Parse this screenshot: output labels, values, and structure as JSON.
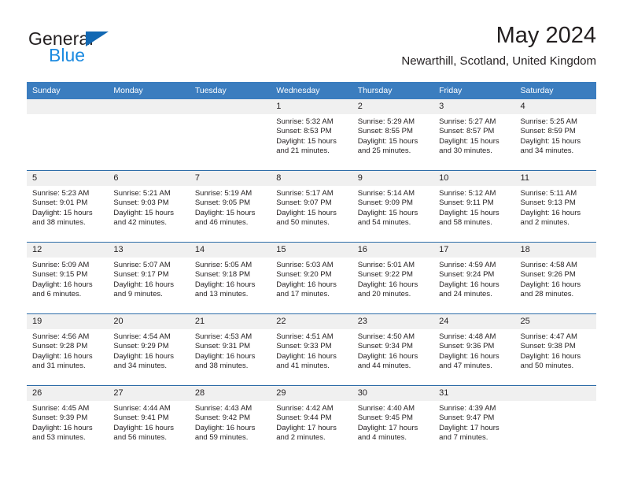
{
  "brand": {
    "name_part1": "General",
    "name_part2": "Blue",
    "accent_color": "#1268b3",
    "blue_text_color": "#1b8ae0"
  },
  "header": {
    "title": "May 2024",
    "subtitle": "Newarthill, Scotland, United Kingdom"
  },
  "theme": {
    "header_row_bg": "#3b7dbf",
    "row_divider": "#2e6da8",
    "daynum_bg": "#f0f0f0"
  },
  "weekday_headers": [
    "Sunday",
    "Monday",
    "Tuesday",
    "Wednesday",
    "Thursday",
    "Friday",
    "Saturday"
  ],
  "labels": {
    "sunrise_prefix": "Sunrise:",
    "sunset_prefix": "Sunset:",
    "daylight_prefix": "Daylight:"
  },
  "weeks": [
    [
      {
        "day": "",
        "empty": true
      },
      {
        "day": "",
        "empty": true
      },
      {
        "day": "",
        "empty": true
      },
      {
        "day": "1",
        "sunrise": "Sunrise: 5:32 AM",
        "sunset": "Sunset: 8:53 PM",
        "daylight_1": "Daylight: 15 hours",
        "daylight_2": "and 21 minutes."
      },
      {
        "day": "2",
        "sunrise": "Sunrise: 5:29 AM",
        "sunset": "Sunset: 8:55 PM",
        "daylight_1": "Daylight: 15 hours",
        "daylight_2": "and 25 minutes."
      },
      {
        "day": "3",
        "sunrise": "Sunrise: 5:27 AM",
        "sunset": "Sunset: 8:57 PM",
        "daylight_1": "Daylight: 15 hours",
        "daylight_2": "and 30 minutes."
      },
      {
        "day": "4",
        "sunrise": "Sunrise: 5:25 AM",
        "sunset": "Sunset: 8:59 PM",
        "daylight_1": "Daylight: 15 hours",
        "daylight_2": "and 34 minutes."
      }
    ],
    [
      {
        "day": "5",
        "sunrise": "Sunrise: 5:23 AM",
        "sunset": "Sunset: 9:01 PM",
        "daylight_1": "Daylight: 15 hours",
        "daylight_2": "and 38 minutes."
      },
      {
        "day": "6",
        "sunrise": "Sunrise: 5:21 AM",
        "sunset": "Sunset: 9:03 PM",
        "daylight_1": "Daylight: 15 hours",
        "daylight_2": "and 42 minutes."
      },
      {
        "day": "7",
        "sunrise": "Sunrise: 5:19 AM",
        "sunset": "Sunset: 9:05 PM",
        "daylight_1": "Daylight: 15 hours",
        "daylight_2": "and 46 minutes."
      },
      {
        "day": "8",
        "sunrise": "Sunrise: 5:17 AM",
        "sunset": "Sunset: 9:07 PM",
        "daylight_1": "Daylight: 15 hours",
        "daylight_2": "and 50 minutes."
      },
      {
        "day": "9",
        "sunrise": "Sunrise: 5:14 AM",
        "sunset": "Sunset: 9:09 PM",
        "daylight_1": "Daylight: 15 hours",
        "daylight_2": "and 54 minutes."
      },
      {
        "day": "10",
        "sunrise": "Sunrise: 5:12 AM",
        "sunset": "Sunset: 9:11 PM",
        "daylight_1": "Daylight: 15 hours",
        "daylight_2": "and 58 minutes."
      },
      {
        "day": "11",
        "sunrise": "Sunrise: 5:11 AM",
        "sunset": "Sunset: 9:13 PM",
        "daylight_1": "Daylight: 16 hours",
        "daylight_2": "and 2 minutes."
      }
    ],
    [
      {
        "day": "12",
        "sunrise": "Sunrise: 5:09 AM",
        "sunset": "Sunset: 9:15 PM",
        "daylight_1": "Daylight: 16 hours",
        "daylight_2": "and 6 minutes."
      },
      {
        "day": "13",
        "sunrise": "Sunrise: 5:07 AM",
        "sunset": "Sunset: 9:17 PM",
        "daylight_1": "Daylight: 16 hours",
        "daylight_2": "and 9 minutes."
      },
      {
        "day": "14",
        "sunrise": "Sunrise: 5:05 AM",
        "sunset": "Sunset: 9:18 PM",
        "daylight_1": "Daylight: 16 hours",
        "daylight_2": "and 13 minutes."
      },
      {
        "day": "15",
        "sunrise": "Sunrise: 5:03 AM",
        "sunset": "Sunset: 9:20 PM",
        "daylight_1": "Daylight: 16 hours",
        "daylight_2": "and 17 minutes."
      },
      {
        "day": "16",
        "sunrise": "Sunrise: 5:01 AM",
        "sunset": "Sunset: 9:22 PM",
        "daylight_1": "Daylight: 16 hours",
        "daylight_2": "and 20 minutes."
      },
      {
        "day": "17",
        "sunrise": "Sunrise: 4:59 AM",
        "sunset": "Sunset: 9:24 PM",
        "daylight_1": "Daylight: 16 hours",
        "daylight_2": "and 24 minutes."
      },
      {
        "day": "18",
        "sunrise": "Sunrise: 4:58 AM",
        "sunset": "Sunset: 9:26 PM",
        "daylight_1": "Daylight: 16 hours",
        "daylight_2": "and 28 minutes."
      }
    ],
    [
      {
        "day": "19",
        "sunrise": "Sunrise: 4:56 AM",
        "sunset": "Sunset: 9:28 PM",
        "daylight_1": "Daylight: 16 hours",
        "daylight_2": "and 31 minutes."
      },
      {
        "day": "20",
        "sunrise": "Sunrise: 4:54 AM",
        "sunset": "Sunset: 9:29 PM",
        "daylight_1": "Daylight: 16 hours",
        "daylight_2": "and 34 minutes."
      },
      {
        "day": "21",
        "sunrise": "Sunrise: 4:53 AM",
        "sunset": "Sunset: 9:31 PM",
        "daylight_1": "Daylight: 16 hours",
        "daylight_2": "and 38 minutes."
      },
      {
        "day": "22",
        "sunrise": "Sunrise: 4:51 AM",
        "sunset": "Sunset: 9:33 PM",
        "daylight_1": "Daylight: 16 hours",
        "daylight_2": "and 41 minutes."
      },
      {
        "day": "23",
        "sunrise": "Sunrise: 4:50 AM",
        "sunset": "Sunset: 9:34 PM",
        "daylight_1": "Daylight: 16 hours",
        "daylight_2": "and 44 minutes."
      },
      {
        "day": "24",
        "sunrise": "Sunrise: 4:48 AM",
        "sunset": "Sunset: 9:36 PM",
        "daylight_1": "Daylight: 16 hours",
        "daylight_2": "and 47 minutes."
      },
      {
        "day": "25",
        "sunrise": "Sunrise: 4:47 AM",
        "sunset": "Sunset: 9:38 PM",
        "daylight_1": "Daylight: 16 hours",
        "daylight_2": "and 50 minutes."
      }
    ],
    [
      {
        "day": "26",
        "sunrise": "Sunrise: 4:45 AM",
        "sunset": "Sunset: 9:39 PM",
        "daylight_1": "Daylight: 16 hours",
        "daylight_2": "and 53 minutes."
      },
      {
        "day": "27",
        "sunrise": "Sunrise: 4:44 AM",
        "sunset": "Sunset: 9:41 PM",
        "daylight_1": "Daylight: 16 hours",
        "daylight_2": "and 56 minutes."
      },
      {
        "day": "28",
        "sunrise": "Sunrise: 4:43 AM",
        "sunset": "Sunset: 9:42 PM",
        "daylight_1": "Daylight: 16 hours",
        "daylight_2": "and 59 minutes."
      },
      {
        "day": "29",
        "sunrise": "Sunrise: 4:42 AM",
        "sunset": "Sunset: 9:44 PM",
        "daylight_1": "Daylight: 17 hours",
        "daylight_2": "and 2 minutes."
      },
      {
        "day": "30",
        "sunrise": "Sunrise: 4:40 AM",
        "sunset": "Sunset: 9:45 PM",
        "daylight_1": "Daylight: 17 hours",
        "daylight_2": "and 4 minutes."
      },
      {
        "day": "31",
        "sunrise": "Sunrise: 4:39 AM",
        "sunset": "Sunset: 9:47 PM",
        "daylight_1": "Daylight: 17 hours",
        "daylight_2": "and 7 minutes."
      },
      {
        "day": "",
        "empty": true
      }
    ]
  ]
}
